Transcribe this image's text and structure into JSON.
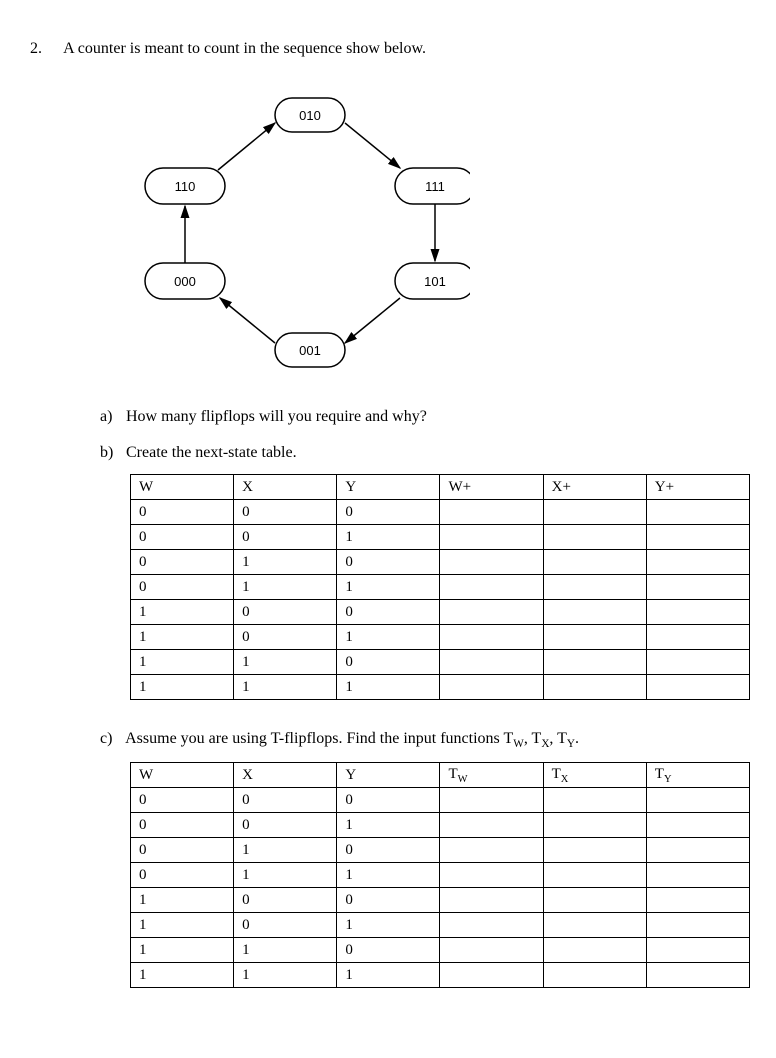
{
  "question": {
    "number": "2.",
    "prompt": "A counter is meant to count  in the sequence show below."
  },
  "diagram": {
    "nodes": {
      "010": "010",
      "110": "110",
      "111": "111",
      "000": "000",
      "101": "101",
      "001": "001"
    }
  },
  "part_a": {
    "label": "a)",
    "text": "How many flipflops will you require and why?"
  },
  "part_b": {
    "label": "b)",
    "text": "Create the next-state table.",
    "headers": [
      "W",
      "X",
      "Y",
      "W+",
      "X+",
      "Y+"
    ],
    "rows": [
      [
        "0",
        "0",
        "0",
        "",
        "",
        ""
      ],
      [
        "0",
        "0",
        "1",
        "",
        "",
        ""
      ],
      [
        "0",
        "1",
        "0",
        "",
        "",
        ""
      ],
      [
        "0",
        "1",
        "1",
        "",
        "",
        ""
      ],
      [
        "1",
        "0",
        "0",
        "",
        "",
        ""
      ],
      [
        "1",
        "0",
        "1",
        "",
        "",
        ""
      ],
      [
        "1",
        "1",
        "0",
        "",
        "",
        ""
      ],
      [
        "1",
        "1",
        "1",
        "",
        "",
        ""
      ]
    ]
  },
  "part_c": {
    "label": "c)",
    "text_prefix": "Assume you are using T-flipflops. Find the input functions T",
    "sub_w": "W",
    "comma_sep": ", T",
    "sub_x": "X",
    "sub_y": "Y",
    "period": ".",
    "headers_plain": [
      "W",
      "X",
      "Y"
    ],
    "headers_t": [
      {
        "base": "T",
        "sub": "W"
      },
      {
        "base": "T",
        "sub": "X"
      },
      {
        "base": "T",
        "sub": "Y"
      }
    ],
    "rows": [
      [
        "0",
        "0",
        "0",
        "",
        "",
        ""
      ],
      [
        "0",
        "0",
        "1",
        "",
        "",
        ""
      ],
      [
        "0",
        "1",
        "0",
        "",
        "",
        ""
      ],
      [
        "0",
        "1",
        "1",
        "",
        "",
        ""
      ],
      [
        "1",
        "0",
        "0",
        "",
        "",
        ""
      ],
      [
        "1",
        "0",
        "1",
        "",
        "",
        ""
      ],
      [
        "1",
        "1",
        "0",
        "",
        "",
        ""
      ],
      [
        "1",
        "1",
        "1",
        "",
        "",
        ""
      ]
    ]
  }
}
